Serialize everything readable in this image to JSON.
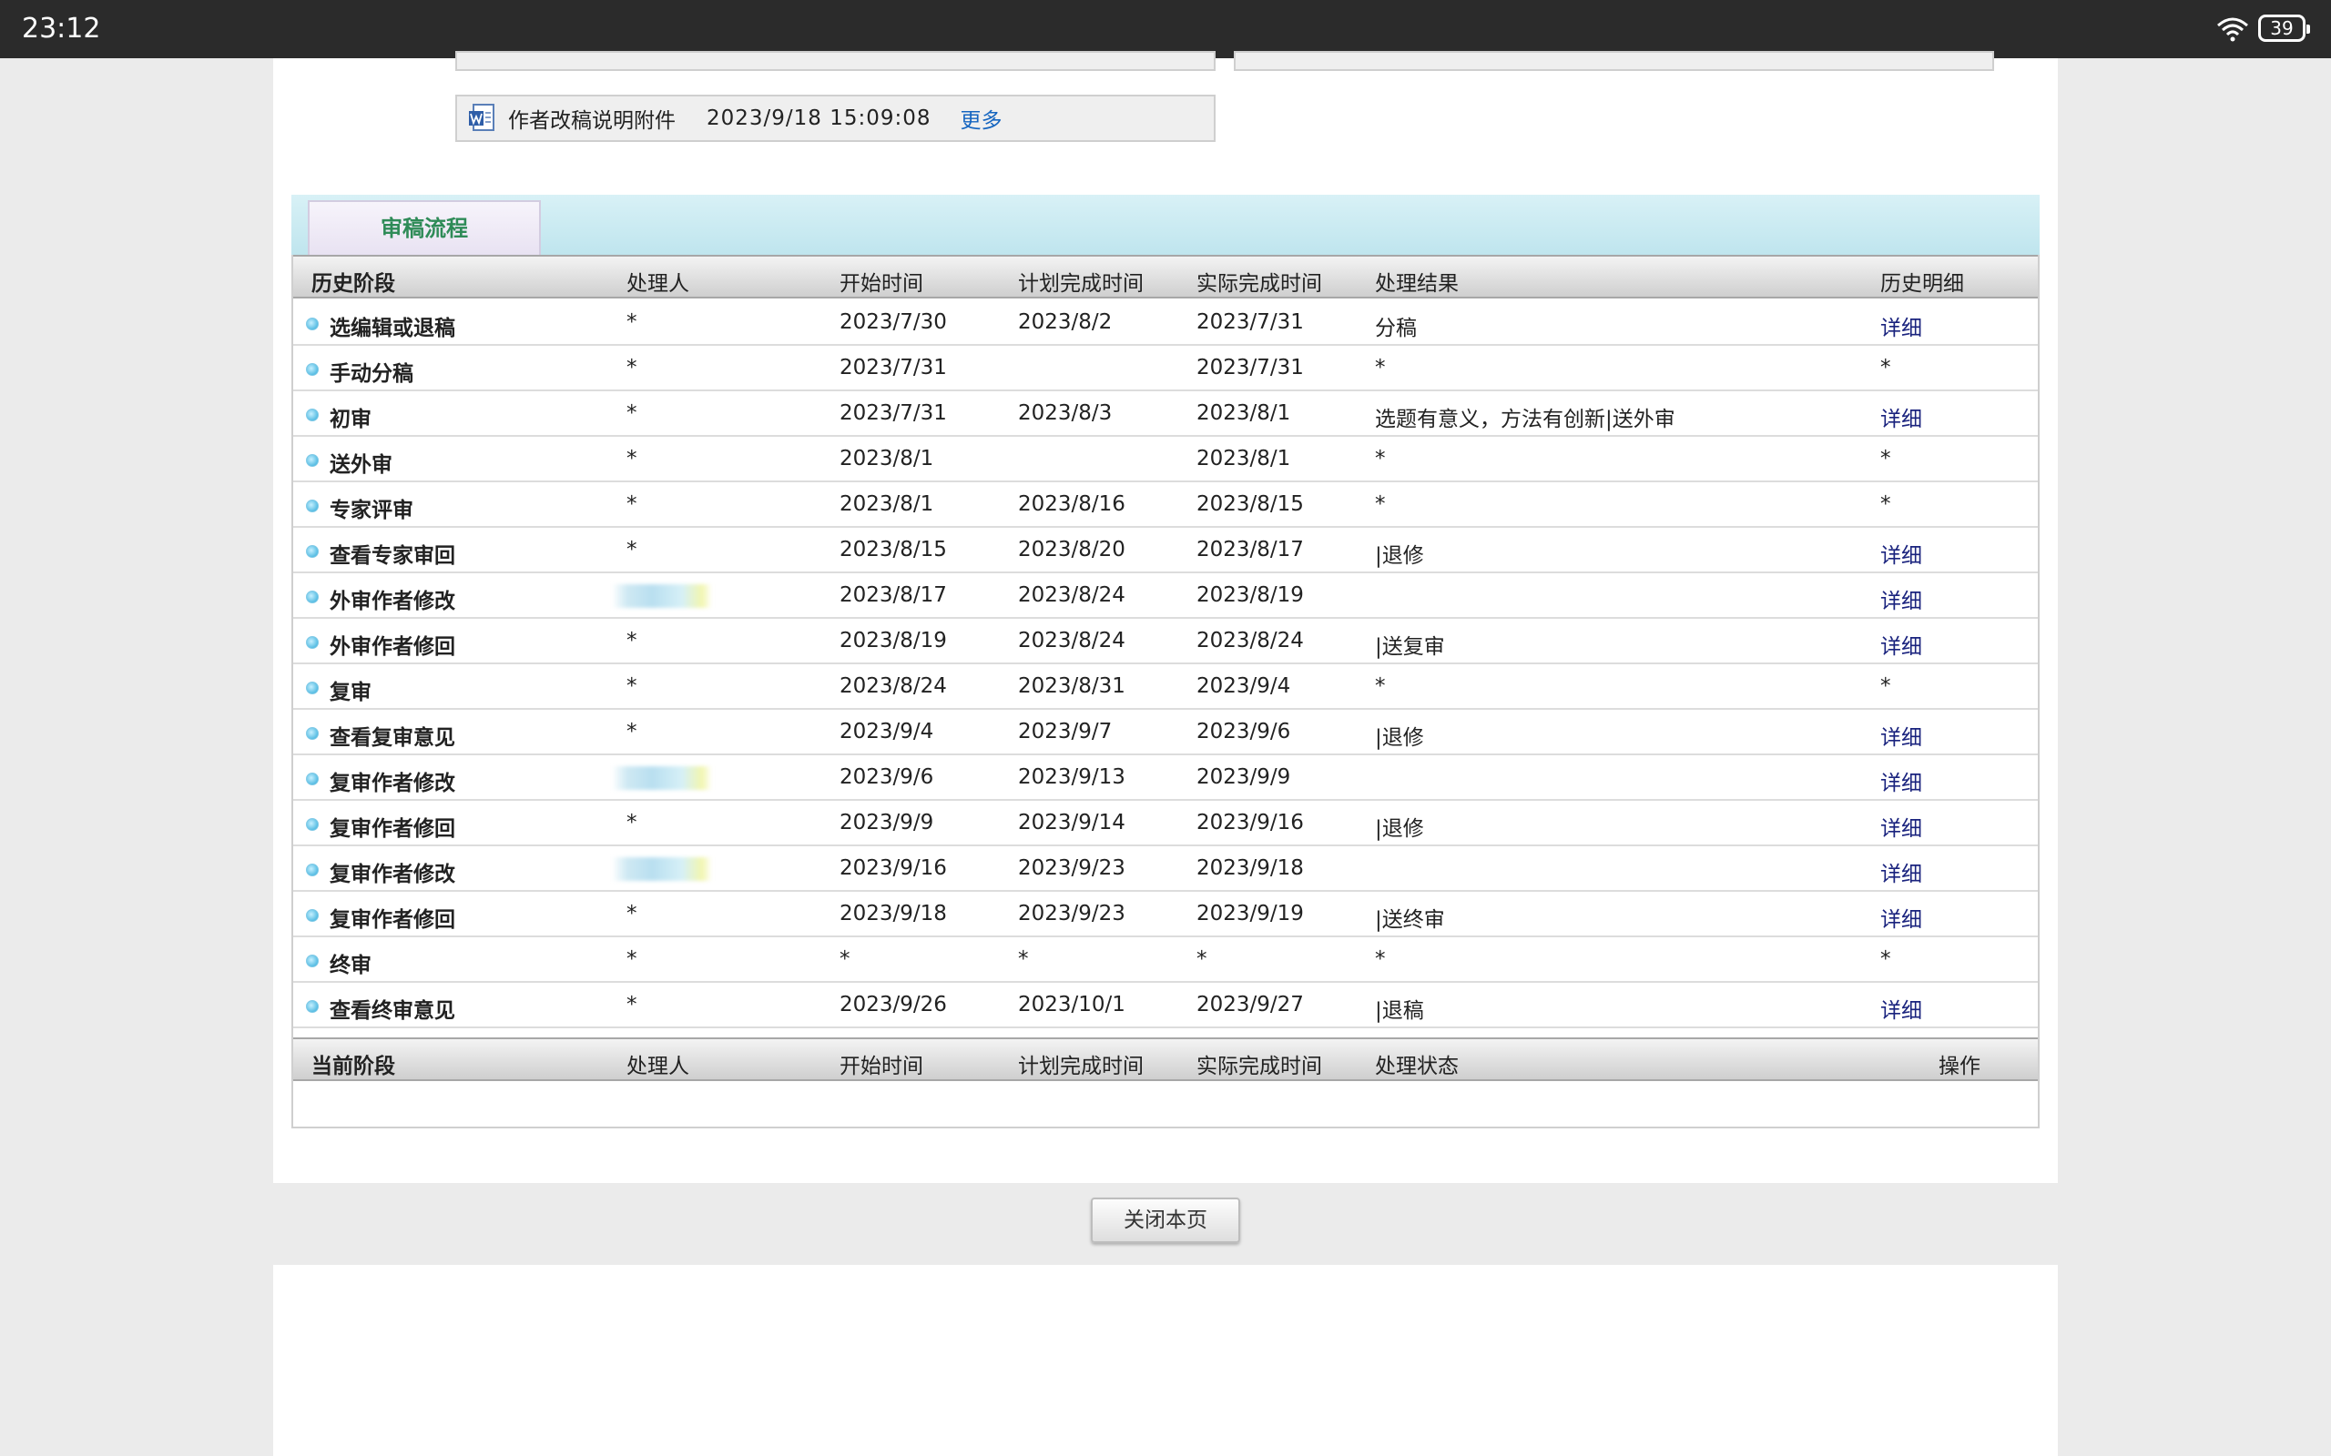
{
  "statusbar": {
    "time": "23:12",
    "battery": "39"
  },
  "attachment": {
    "name": "作者改稿说明附件",
    "date": "2023/9/18 15:09:08",
    "more": "更多"
  },
  "process": {
    "tab": "审稿流程",
    "history_header": {
      "stage": "历史阶段",
      "handler": "处理人",
      "start": "开始时间",
      "planned": "计划完成时间",
      "actual": "实际完成时间",
      "result": "处理结果",
      "detail": "历史明细"
    },
    "rows": [
      {
        "stage": "选编辑或退稿",
        "handler": "*",
        "start": "2023/7/30",
        "planned": "2023/8/2",
        "actual": "2023/7/31",
        "result": "分稿",
        "detail": "详细"
      },
      {
        "stage": "手动分稿",
        "handler": "*",
        "start": "2023/7/31",
        "planned": "",
        "actual": "2023/7/31",
        "result": "*",
        "detail": "*"
      },
      {
        "stage": "初审",
        "handler": "*",
        "start": "2023/7/31",
        "planned": "2023/8/3",
        "actual": "2023/8/1",
        "result": "选题有意义，方法有创新|送外审",
        "detail": "详细"
      },
      {
        "stage": "送外审",
        "handler": "*",
        "start": "2023/8/1",
        "planned": "",
        "actual": "2023/8/1",
        "result": "*",
        "detail": "*"
      },
      {
        "stage": "专家评审",
        "handler": "*",
        "start": "2023/8/1",
        "planned": "2023/8/16",
        "actual": "2023/8/15",
        "result": "*",
        "detail": "*"
      },
      {
        "stage": "查看专家审回",
        "handler": "*",
        "start": "2023/8/15",
        "planned": "2023/8/20",
        "actual": "2023/8/17",
        "result": "|退修",
        "detail": "详细"
      },
      {
        "stage": "外审作者修改",
        "handler": "",
        "start": "2023/8/17",
        "planned": "2023/8/24",
        "actual": "2023/8/19",
        "result": "",
        "detail": "详细"
      },
      {
        "stage": "外审作者修回",
        "handler": "*",
        "start": "2023/8/19",
        "planned": "2023/8/24",
        "actual": "2023/8/24",
        "result": "|送复审",
        "detail": "详细"
      },
      {
        "stage": "复审",
        "handler": "*",
        "start": "2023/8/24",
        "planned": "2023/8/31",
        "actual": "2023/9/4",
        "result": "*",
        "detail": "*"
      },
      {
        "stage": "查看复审意见",
        "handler": "*",
        "start": "2023/9/4",
        "planned": "2023/9/7",
        "actual": "2023/9/6",
        "result": "|退修",
        "detail": "详细"
      },
      {
        "stage": "复审作者修改",
        "handler": "",
        "start": "2023/9/6",
        "planned": "2023/9/13",
        "actual": "2023/9/9",
        "result": "",
        "detail": "详细"
      },
      {
        "stage": "复审作者修回",
        "handler": "*",
        "start": "2023/9/9",
        "planned": "2023/9/14",
        "actual": "2023/9/16",
        "result": "|退修",
        "detail": "详细"
      },
      {
        "stage": "复审作者修改",
        "handler": "",
        "start": "2023/9/16",
        "planned": "2023/9/23",
        "actual": "2023/9/18",
        "result": "",
        "detail": "详细"
      },
      {
        "stage": "复审作者修回",
        "handler": "*",
        "start": "2023/9/18",
        "planned": "2023/9/23",
        "actual": "2023/9/19",
        "result": "|送终审",
        "detail": "详细"
      },
      {
        "stage": "终审",
        "handler": "*",
        "start": "*",
        "planned": "*",
        "actual": "*",
        "result": "*",
        "detail": "*"
      },
      {
        "stage": "查看终审意见",
        "handler": "*",
        "start": "2023/9/26",
        "planned": "2023/10/1",
        "actual": "2023/9/27",
        "result": "|退稿",
        "detail": "详细"
      }
    ],
    "current_header": {
      "stage": "当前阶段",
      "handler": "处理人",
      "start": "开始时间",
      "planned": "计划完成时间",
      "actual": "实际完成时间",
      "status": "处理状态",
      "op": "操作"
    }
  },
  "close_button": "关闭本页"
}
